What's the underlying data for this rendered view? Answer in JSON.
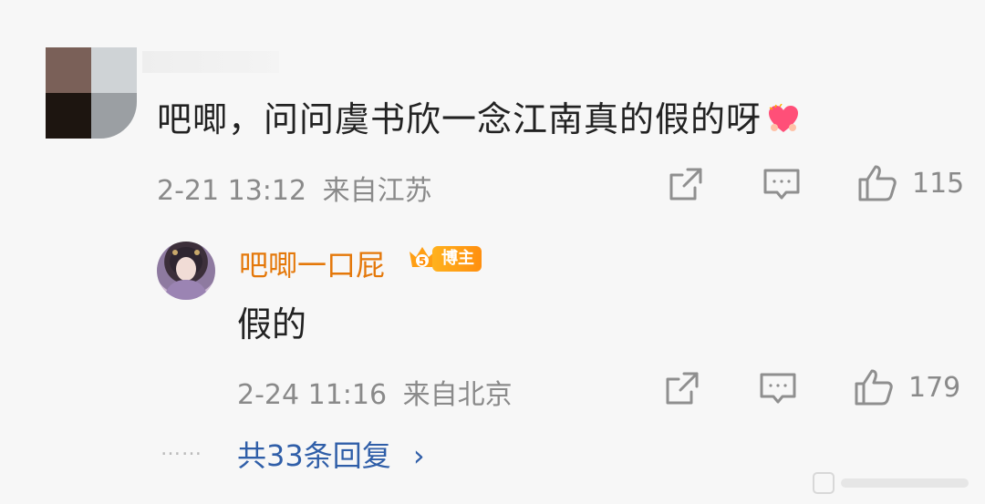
{
  "comment": {
    "text": "吧唧，问问虞书欣一念江南真的假的呀",
    "emoji": "heart-emoji",
    "time": "2-21 13:12",
    "location": "来自江苏",
    "like_count": "115"
  },
  "reply": {
    "author": "吧唧一口屁",
    "badge_level": "5",
    "badge_label": "博主",
    "text": "假的",
    "time": "2-24 11:16",
    "location": "来自北京",
    "like_count": "179"
  },
  "more": {
    "dots": "……",
    "label": "共33条回复",
    "chevron": "›"
  },
  "colors": {
    "background": "#f7f7f7",
    "author_name": "#e4780a",
    "link": "#2f5ea8",
    "meta": "#8a8a8a",
    "badge": "#ff9f14"
  }
}
